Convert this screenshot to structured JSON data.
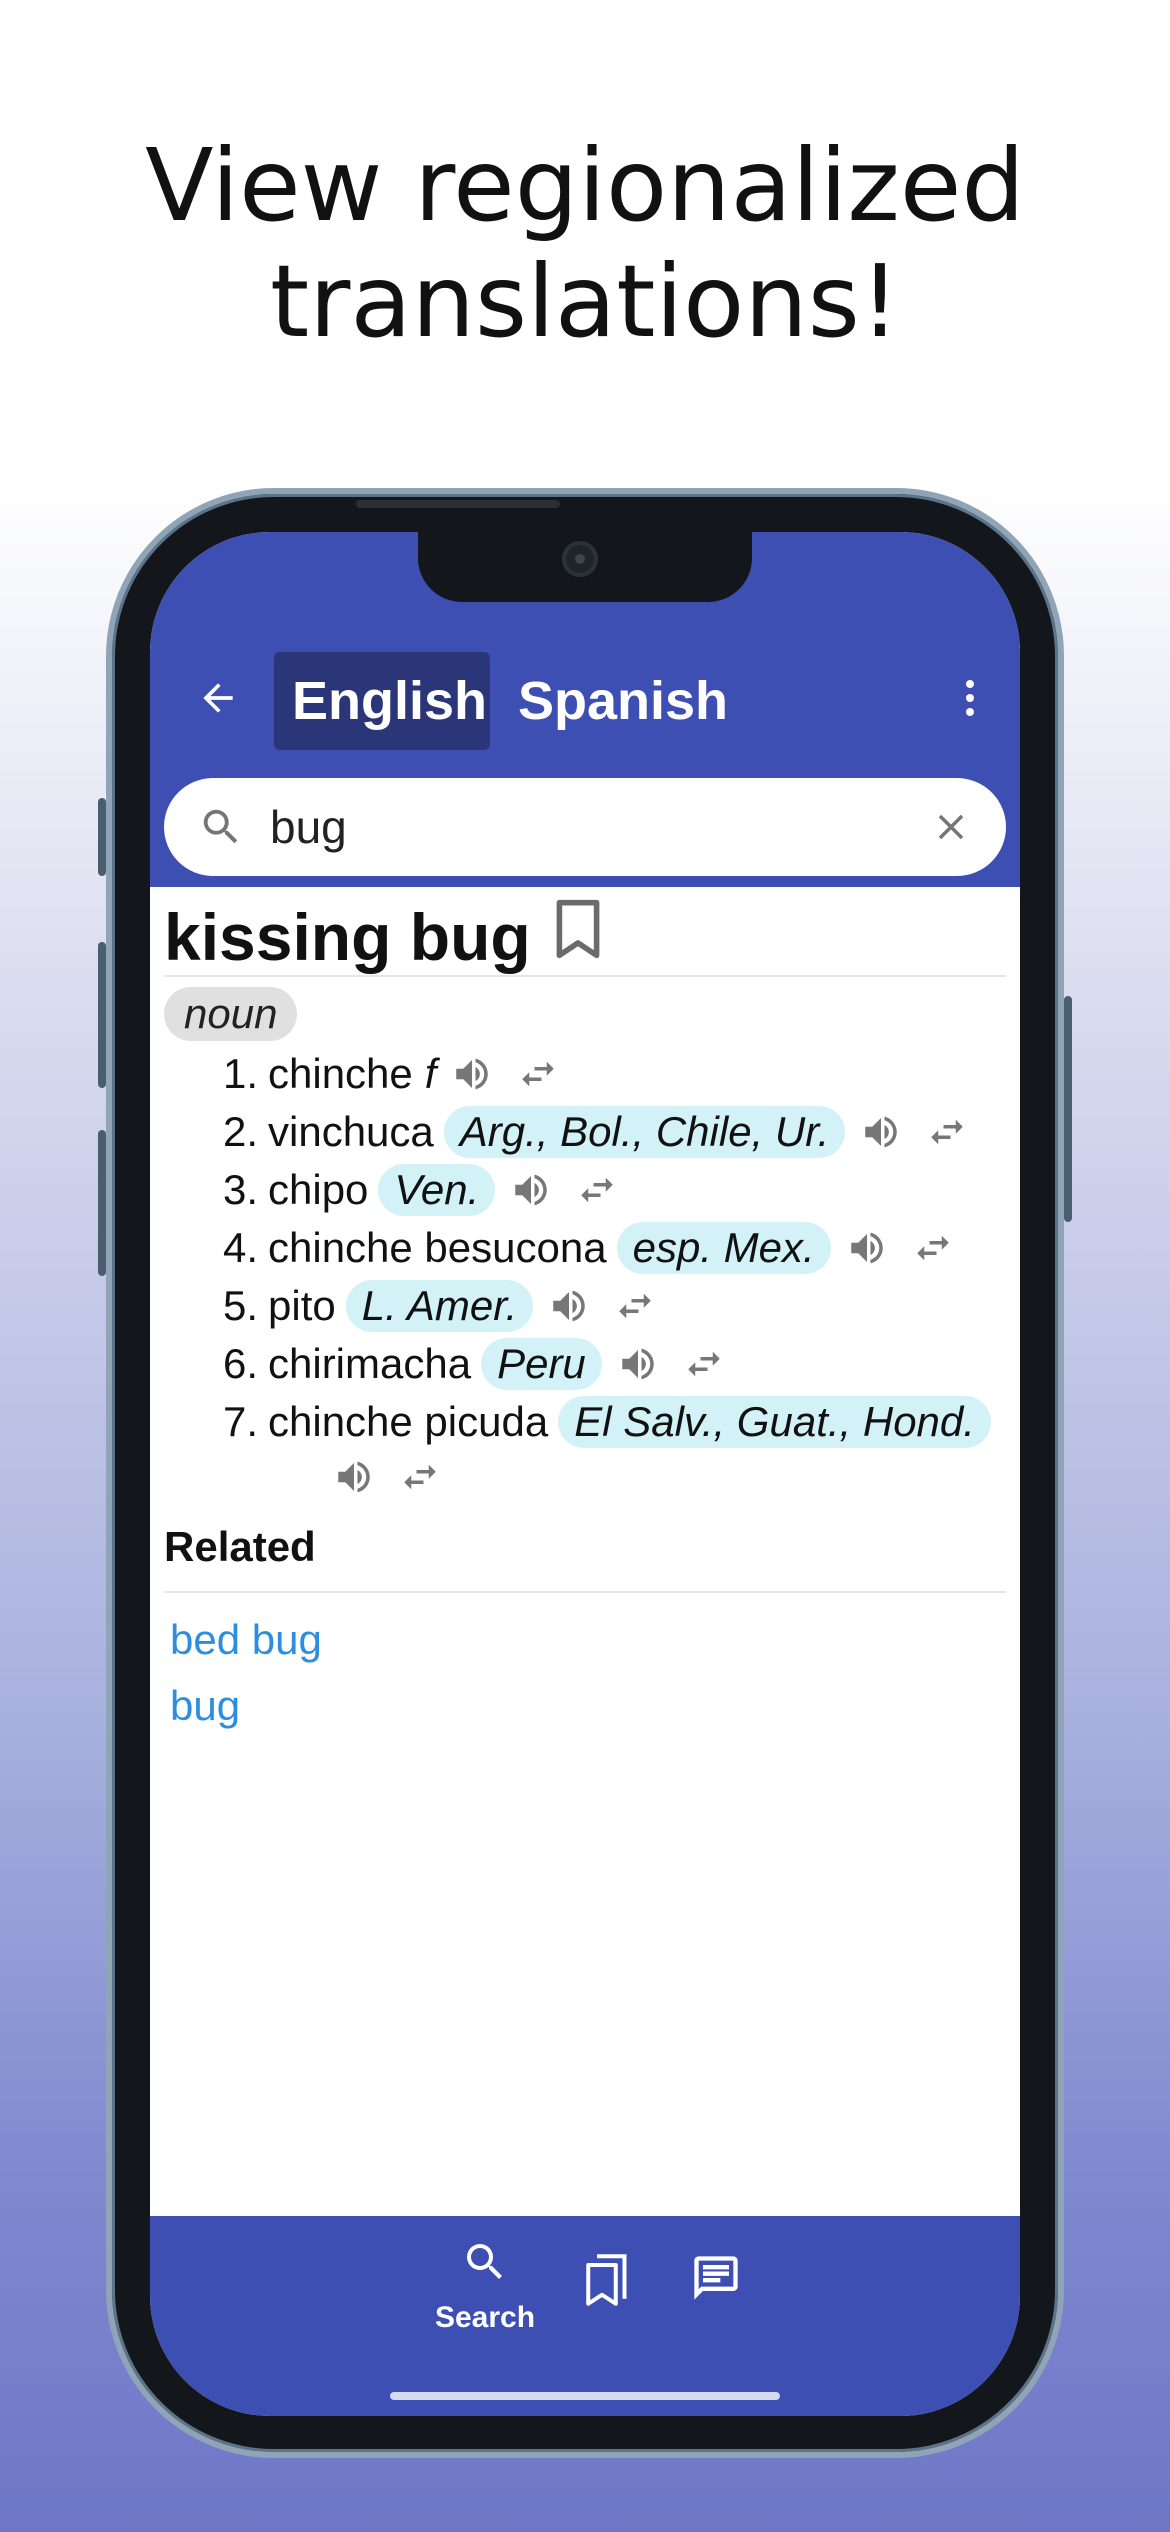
{
  "headline": {
    "line1": "View regionalized",
    "line2": "translations!"
  },
  "app_bar": {
    "back_icon": "arrow-left-icon",
    "tabs": [
      {
        "label": "English",
        "selected": true
      },
      {
        "label": "Spanish",
        "selected": false
      }
    ],
    "menu_icon": "more-vert-icon"
  },
  "search": {
    "value": "bug",
    "icon": "search-icon",
    "clear_icon": "close-icon"
  },
  "entry": {
    "headword": "kissing bug",
    "bookmark_icon": "bookmark-outline-icon",
    "part_of_speech": "noun",
    "senses": [
      {
        "number": "1.",
        "word": "chinche",
        "gender": "f",
        "region": ""
      },
      {
        "number": "2.",
        "word": "vinchuca",
        "gender": "",
        "region": "Arg., Bol., Chile, Ur."
      },
      {
        "number": "3.",
        "word": "chipo",
        "gender": "",
        "region": "Ven."
      },
      {
        "number": "4.",
        "word": "chinche besucona",
        "gender": "",
        "region": "esp. Mex."
      },
      {
        "number": "5.",
        "word": "pito",
        "gender": "",
        "region": "L. Amer."
      },
      {
        "number": "6.",
        "word": "chirimacha",
        "gender": "",
        "region": "Peru"
      },
      {
        "number": "7.",
        "word": "chinche picuda",
        "gender": "",
        "region": "El Salv., Guat., Hond."
      }
    ],
    "sense_icons": {
      "audio": "speaker-icon",
      "swap": "swap-horizontal-icon"
    }
  },
  "related": {
    "title": "Related",
    "links": [
      "bed bug",
      "bug"
    ]
  },
  "bottom_nav": {
    "search_label": "Search",
    "items": [
      "search-icon",
      "bookmarks-icon",
      "chat-icon"
    ]
  },
  "colors": {
    "app_bar": "#3e4fb4",
    "selected_tab": "#2a3677",
    "region_chip": "#d3f2f8",
    "link": "#2d8ee0"
  }
}
